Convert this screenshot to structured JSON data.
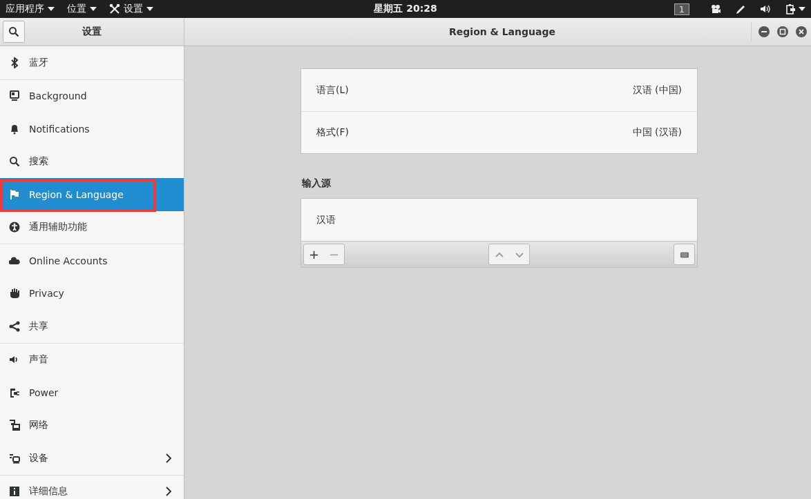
{
  "top_bar": {
    "menus": [
      {
        "label": "应用程序",
        "icon": false
      },
      {
        "label": "位置",
        "icon": false
      },
      {
        "label": "设置",
        "icon": true
      }
    ],
    "clock": "星期五 20:28",
    "workspace": "1"
  },
  "sidebar": {
    "title": "设置",
    "groups": [
      [
        {
          "label": "蓝牙",
          "selected": false,
          "annotated": false,
          "submenu": false
        }
      ],
      [
        {
          "label": "Background",
          "selected": false,
          "annotated": false,
          "submenu": false
        },
        {
          "label": "Notifications",
          "selected": false,
          "annotated": false,
          "submenu": false
        },
        {
          "label": "搜索",
          "selected": false,
          "annotated": false,
          "submenu": false
        },
        {
          "label": "Region & Language",
          "selected": true,
          "annotated": true,
          "submenu": false
        },
        {
          "label": "通用辅助功能",
          "selected": false,
          "annotated": false,
          "submenu": false
        }
      ],
      [
        {
          "label": "Online Accounts",
          "selected": false,
          "annotated": false,
          "submenu": false
        },
        {
          "label": "Privacy",
          "selected": false,
          "annotated": false,
          "submenu": false
        },
        {
          "label": "共享",
          "selected": false,
          "annotated": false,
          "submenu": false
        }
      ],
      [
        {
          "label": "声音",
          "selected": false,
          "annotated": false,
          "submenu": false
        },
        {
          "label": "Power",
          "selected": false,
          "annotated": false,
          "submenu": false
        },
        {
          "label": "网络",
          "selected": false,
          "annotated": false,
          "submenu": false
        },
        {
          "label": "设备",
          "selected": false,
          "annotated": false,
          "submenu": true
        }
      ],
      [
        {
          "label": "详细信息",
          "selected": false,
          "annotated": false,
          "submenu": true
        }
      ]
    ]
  },
  "panel": {
    "title": "Region & Language",
    "settings": [
      {
        "label": "语言(L)",
        "value": "汉语 (中国)"
      },
      {
        "label": "格式(F)",
        "value": "中国 (汉语)"
      }
    ],
    "input_sources": {
      "heading": "输入源",
      "items": [
        "汉语"
      ],
      "buttons": [
        {
          "label": "+",
          "disabled": false
        },
        {
          "label": "−",
          "disabled": true
        }
      ],
      "move_up_disabled": true,
      "move_down_disabled": true
    }
  }
}
